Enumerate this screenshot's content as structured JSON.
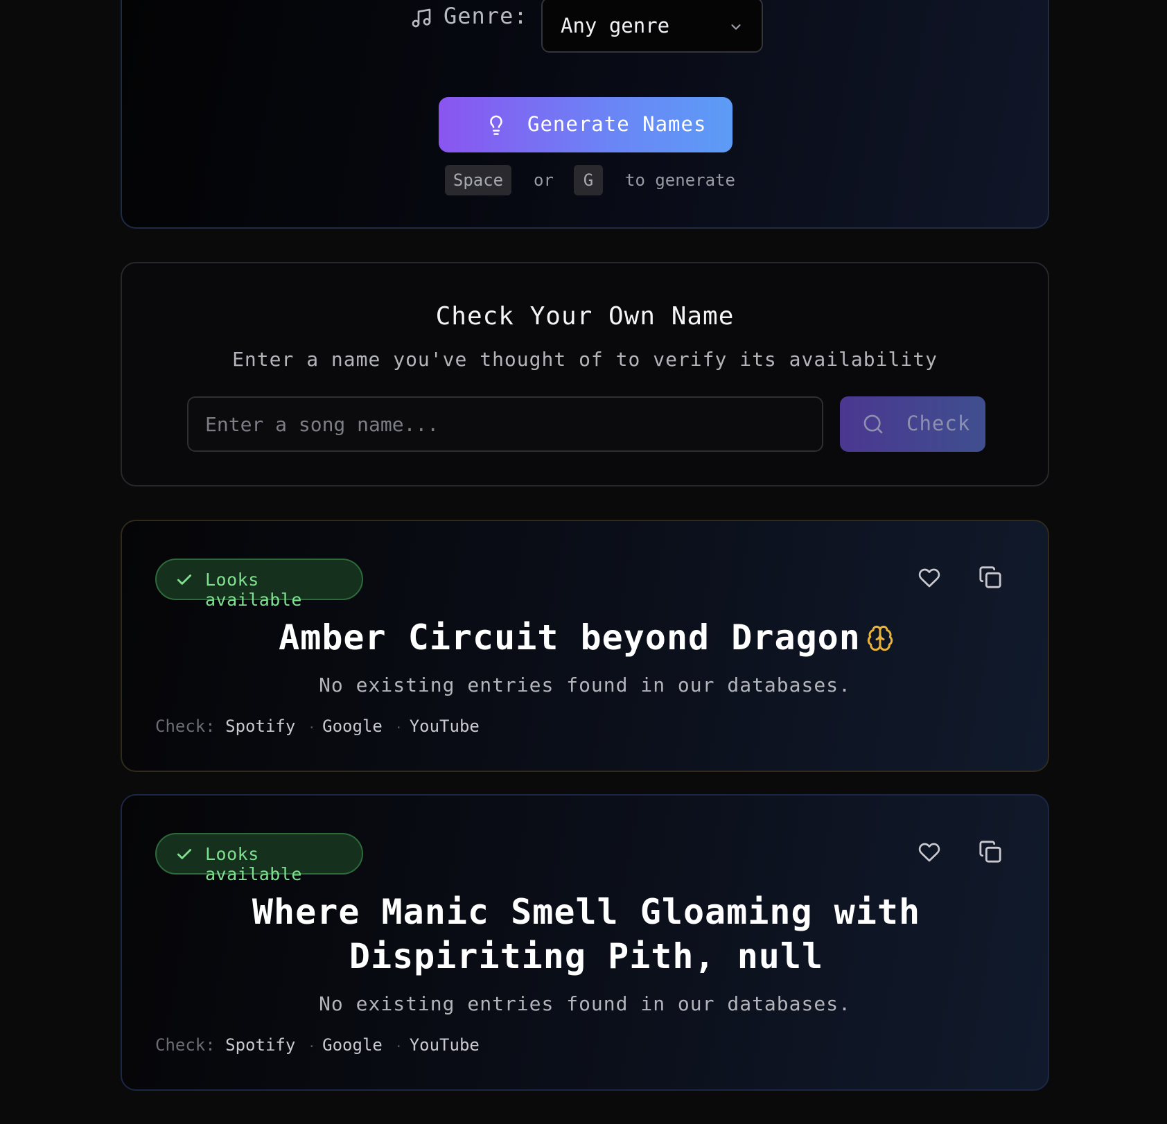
{
  "generator": {
    "genre_label": "Genre:",
    "genre_value": "Any genre",
    "generate_label": "Generate Names",
    "hint": {
      "key1": "Space",
      "or": "or",
      "key2": "G",
      "tail": "to generate"
    }
  },
  "check_own": {
    "title": "Check Your Own Name",
    "subtitle": "Enter a name you've thought of to verify its availability",
    "input_placeholder": "Enter a song name...",
    "button_label": "Check"
  },
  "results": [
    {
      "badge": "Looks available",
      "title": "Amber Circuit beyond Dragon",
      "status": "No existing entries found in our databases.",
      "check_label": "Check:",
      "links": [
        "Spotify",
        "Google",
        "YouTube"
      ]
    },
    {
      "badge": "Looks available",
      "title": "Where Manic Smell Gloaming with Dispiriting Pith, null",
      "status": "No existing entries found in our databases.",
      "check_label": "Check:",
      "links": [
        "Spotify",
        "Google",
        "YouTube"
      ]
    }
  ],
  "icons": {
    "genre": "music-note-icon",
    "select": "chevron-down-icon",
    "generate": "lightbulb-icon",
    "check": "search-icon",
    "badge": "checkmark-icon",
    "favorite": "heart-icon",
    "copy": "copy-icon",
    "title_marker": "brain-icon"
  },
  "colors": {
    "accent_start": "#8a55f0",
    "accent_end": "#5c9cf6",
    "available_green": "#7fe08f",
    "brain_gold": "#e8b43c"
  }
}
